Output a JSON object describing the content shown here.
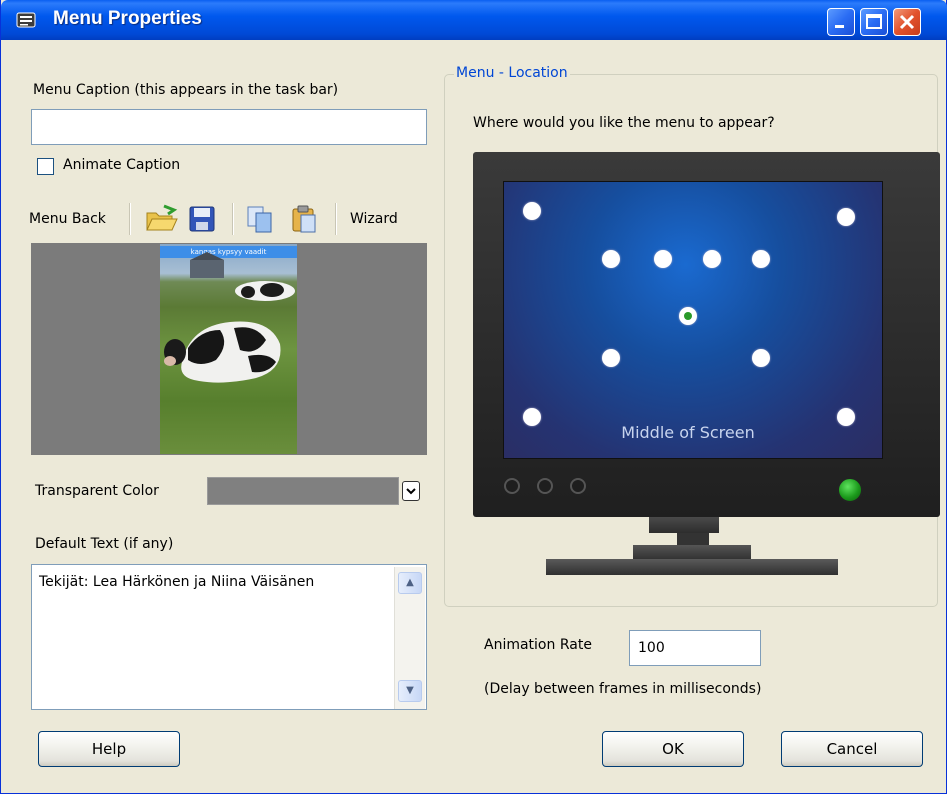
{
  "window": {
    "title": "Menu Properties"
  },
  "caption": {
    "label": "Menu Caption (this appears in the task bar)",
    "value": ""
  },
  "animate_caption": {
    "label": "Animate Caption",
    "checked": false
  },
  "toolbar": {
    "menu_back_label": "Menu Back",
    "wizard_label": "Wizard"
  },
  "photo": {
    "banner_text": "kangas kypsyy vaadit"
  },
  "transparent_color": {
    "label": "Transparent Color",
    "value": "#808080"
  },
  "default_text": {
    "label": "Default Text (if any)",
    "value": "Tekijät: Lea Härkönen ja Niina Väisänen"
  },
  "location": {
    "group_label": "Menu - Location",
    "question": "Where would you like the menu to appear?",
    "selected_caption": "Middle of Screen"
  },
  "animation": {
    "label": "Animation Rate",
    "value": "100",
    "hint": "(Delay between frames in milliseconds)"
  },
  "buttons": {
    "help": "Help",
    "ok": "OK",
    "cancel": "Cancel"
  },
  "colors": {
    "title_bar": "#0058ee",
    "dialog_bg": "#ece9d8",
    "group_legend": "#0046d5",
    "screen": "#164e9e"
  }
}
